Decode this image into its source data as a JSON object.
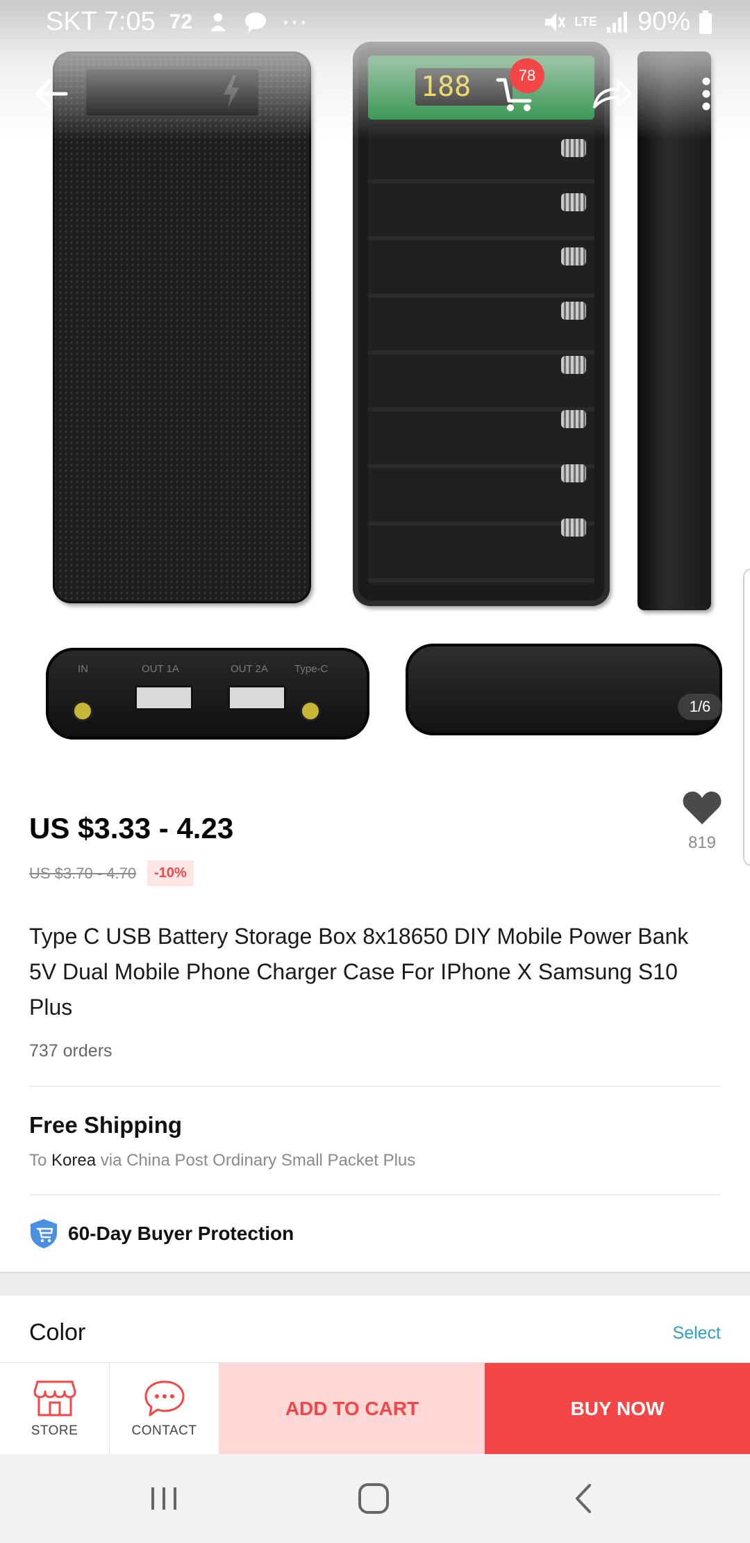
{
  "status_bar": {
    "carrier_time": "SKT 7:05",
    "notification_count": "72",
    "battery": "90%",
    "network": "LTE"
  },
  "header": {
    "cart_badge": "78",
    "image_counter": "1/6"
  },
  "product": {
    "price": "US $3.33 - 4.23",
    "original_price": "US $3.70 - 4.70",
    "discount": "-10%",
    "wishlist_count": "819",
    "title": "Type C USB Battery Storage Box 8x18650 DIY Mobile Power Bank 5V Dual Mobile Phone Charger Case For IPhone X  Samsung S10 Plus",
    "orders": "737 orders"
  },
  "image_labels": {
    "led": "188",
    "port_in": "IN",
    "port_out1": "OUT 1A",
    "port_out2": "OUT 2A",
    "port_typec": "Type-C"
  },
  "shipping": {
    "title": "Free Shipping",
    "prefix": "To",
    "country": "Korea",
    "method": "via China Post Ordinary Small Packet Plus"
  },
  "protection": {
    "label": "60-Day Buyer Protection"
  },
  "color": {
    "label": "Color",
    "select": "Select"
  },
  "action_bar": {
    "store_label": "STORE",
    "contact_label": "CONTACT",
    "add_to_cart": "ADD TO CART",
    "buy_now": "BUY NOW"
  },
  "colors": {
    "accent_red": "#f44646",
    "add_to_cart_bg": "#ffd7d7",
    "link_blue": "#2ba0c8",
    "shield_blue": "#4a90e2"
  },
  "icons": {
    "back": "arrow-left-icon",
    "cart": "cart-icon",
    "share": "share-icon",
    "more": "more-vertical-icon",
    "wishlist": "heart-icon",
    "protection": "shield-cart-icon",
    "store": "store-icon",
    "contact": "chat-icon"
  }
}
